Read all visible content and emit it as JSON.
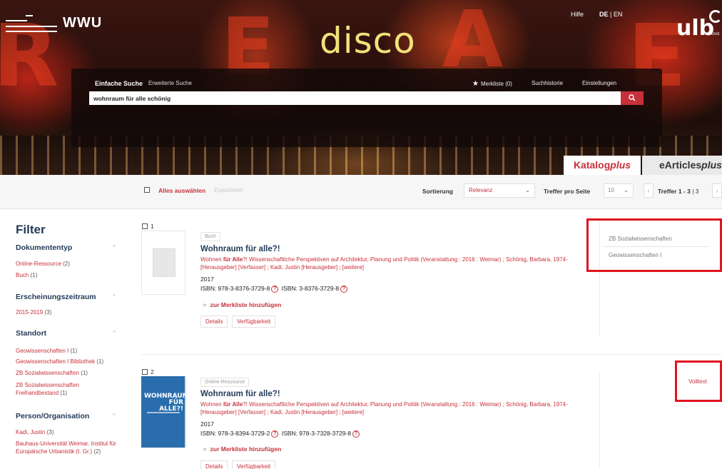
{
  "header": {
    "logo_text": "WWU",
    "app_title": "disco",
    "help_label": "Hilfe",
    "lang_de": "DE",
    "lang_sep": " | ",
    "lang_en": "EN",
    "ulb_logo": "ulb",
    "ulb_sub": "Münst"
  },
  "search": {
    "tab_simple": "Einfache Suche",
    "tab_advanced": "Erweiterte Suche",
    "merkliste": "Merkliste (0)",
    "history": "Suchhistorie",
    "settings": "Einstellungen",
    "query": "wohnraum für alle schönig",
    "search_icon": "magnifier-icon"
  },
  "tabs": {
    "katalog_main": "Katalog",
    "katalog_italic": "plus",
    "earticles_main": "eArticles",
    "earticles_italic": "plus"
  },
  "toolbar": {
    "select_all": "Alles auswählen",
    "export": "Exportieren",
    "sort_label": "Sortierung",
    "sort_value": "Relevanz",
    "per_page_label": "Treffer pro Seite",
    "per_page_value": "10",
    "treffer_label": "Treffer 1 - 3",
    "treffer_total": "| 3"
  },
  "filter": {
    "title": "Filter",
    "groups": [
      {
        "title": "Dokumententyp",
        "items": [
          {
            "label": "Online-Ressource",
            "count": "(2)"
          },
          {
            "label": "Buch",
            "count": "(1)"
          }
        ]
      },
      {
        "title": "Erscheinungszeitraum",
        "items": [
          {
            "label": "2015-2019",
            "count": "(3)"
          }
        ]
      },
      {
        "title": "Standort",
        "items": [
          {
            "label": "Geowissenschaften I",
            "count": "(1)"
          },
          {
            "label": "Geowissenschaften I Bibliothek",
            "count": "(1)"
          },
          {
            "label": "ZB Sozialwissenschaften",
            "count": "(1)"
          },
          {
            "label": "ZB Sozialwissenschaften Freihandbestand",
            "count": "(1)"
          }
        ]
      },
      {
        "title": "Person/Organisation",
        "items": [
          {
            "label": "Kadi, Justin",
            "count": "(3)"
          },
          {
            "label": "Bauhaus-Universität Weimar. Institut für Europäische Urbanistik (I. Gr.)",
            "count": "(2)"
          }
        ]
      }
    ]
  },
  "results": [
    {
      "number": "1",
      "type": "Buch",
      "title": "Wohnraum für alle?!",
      "desc_pre": "Wohnen ",
      "desc_bold": "für Alle",
      "desc_post": "?! Wissenschaftliche Perspektiven auf Architektur, Planung und Politik (Veranstaltung : 2016 : Weimar) ; Schönig, Barbara, 1974- [Herausgeber] [Verfasser] ; Kadi, Justin [Herausgeber] ; [weitere]",
      "year": "2017",
      "isbn1": "ISBN: 978-3-8376-3729-8",
      "isbn2": "ISBN: 3-8376-3729-8",
      "merkliste": "zur Merkliste hinzufügen",
      "btn_details": "Details",
      "btn_avail": "Verfügbarkeit",
      "locations": [
        "ZB Sozialwissenschaften",
        "Geowissenschaften I"
      ]
    },
    {
      "number": "2",
      "type": "Online-Ressource",
      "title": "Wohnraum für alle?!",
      "cover_text": "WOHNRAUM FÜR ALLE?!",
      "desc_pre": "Wohnen ",
      "desc_bold": "für Alle",
      "desc_post": "?! Wissenschaftliche Perspektiven auf Architektur, Planung und Politik (Veranstaltung : 2016 : Weimar) ; Schönig, Barbara, 1974- [Herausgeber] [Verfasser] ; Kadi, Justin [Herausgeber] ; [weitere]",
      "year": "2017",
      "isbn1": "ISBN: 978-3-8394-3729-2",
      "isbn2": "ISBN: 978-3-7328-3729-8",
      "merkliste": "zur Merkliste hinzufügen",
      "btn_details": "Details",
      "btn_avail": "Verfügbarkeit",
      "volltext": "Volltext"
    }
  ],
  "colors": {
    "accent": "#c6303a",
    "heading": "#243b5a",
    "highlight_box": "#e0141f"
  }
}
